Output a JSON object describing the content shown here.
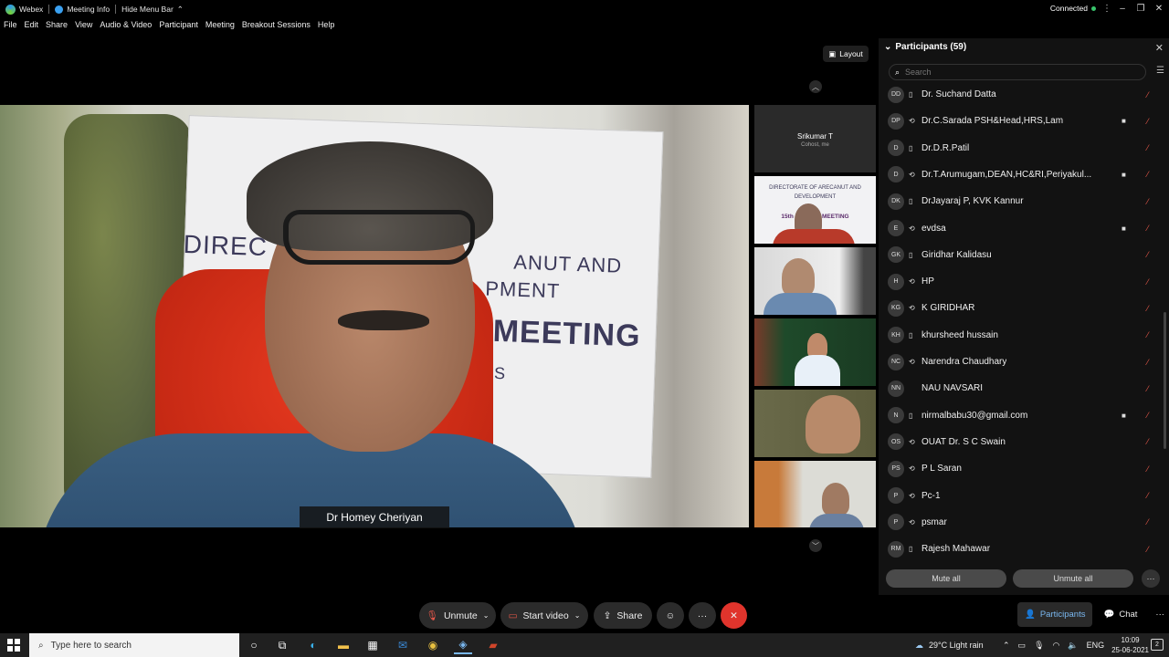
{
  "titlebar": {
    "app_name": "Webex",
    "meeting_info": "Meeting Info",
    "hide_menu_bar": "Hide Menu Bar",
    "status": "Connected"
  },
  "menu": [
    "File",
    "Edit",
    "Share",
    "View",
    "Audio & Video",
    "Participant",
    "Meeting",
    "Breakout Sessions",
    "Help"
  ],
  "layout_button": "Layout",
  "main_video": {
    "speaker_name": "Dr Homey Cheriyan",
    "banner_line1": "DIREC",
    "banner_line2": "ANUT AND",
    "banner_line3": "PMENT",
    "banner_line4": "MEETING",
    "banner_line5": "ES"
  },
  "thumbnails": {
    "first": {
      "name": "Srikumar T",
      "role": "Cohost, me"
    },
    "banner_line1": "DIRECTORATE OF ARECANUT AND",
    "banner_line2": "DEVELOPMENT",
    "banner_line3": "15th AN    VIEW MEETING"
  },
  "participants_panel": {
    "title": "Participants (59)",
    "search_placeholder": "Search",
    "mute_all": "Mute all",
    "unmute_all": "Unmute all",
    "participants": [
      {
        "initials": "DD",
        "name": "Dr. Suchand Datta",
        "device": "phone",
        "video": false
      },
      {
        "initials": "DP",
        "name": "Dr.C.Sarada PSH&Head,HRS,Lam",
        "device": "audio",
        "video": true
      },
      {
        "initials": "D",
        "name": "Dr.D.R.Patil",
        "device": "phone",
        "video": false
      },
      {
        "initials": "D",
        "name": "Dr.T.Arumugam,DEAN,HC&RI,Periyakul...",
        "device": "audio",
        "video": true
      },
      {
        "initials": "DK",
        "name": "DrJayaraj P, KVK Kannur",
        "device": "phone",
        "video": false
      },
      {
        "initials": "E",
        "name": "evdsa",
        "device": "audio",
        "video": true
      },
      {
        "initials": "GK",
        "name": "Giridhar Kalidasu",
        "device": "phone",
        "video": false
      },
      {
        "initials": "H",
        "name": "HP",
        "device": "audio",
        "video": false
      },
      {
        "initials": "KG",
        "name": "K GIRIDHAR",
        "device": "audio",
        "video": false
      },
      {
        "initials": "KH",
        "name": "khursheed hussain",
        "device": "phone",
        "video": false
      },
      {
        "initials": "NC",
        "name": "Narendra Chaudhary",
        "device": "audio",
        "video": false
      },
      {
        "initials": "NN",
        "name": "NAU NAVSARI",
        "device": "none",
        "video": false
      },
      {
        "initials": "N",
        "name": "nirmalbabu30@gmail.com",
        "device": "phone",
        "video": true
      },
      {
        "initials": "OS",
        "name": "OUAT Dr. S C Swain",
        "device": "audio",
        "video": false
      },
      {
        "initials": "PS",
        "name": "P L Saran",
        "device": "audio",
        "video": false
      },
      {
        "initials": "P",
        "name": "Pc-1",
        "device": "audio",
        "video": false
      },
      {
        "initials": "P",
        "name": "psmar",
        "device": "audio",
        "video": false
      },
      {
        "initials": "RM",
        "name": "Rajesh Mahawar",
        "device": "phone",
        "video": false
      }
    ]
  },
  "controls": {
    "unmute": "Unmute",
    "start_video": "Start video",
    "share": "Share",
    "participants_tab": "Participants",
    "chat_tab": "Chat"
  },
  "taskbar": {
    "search_placeholder": "Type here to search",
    "weather": "29°C  Light rain",
    "language": "ENG",
    "time": "10:09",
    "date": "25-06-2021",
    "notification_count": "2"
  },
  "colors": {
    "accent_blue": "#7ab8f0",
    "end_red": "#e0342c",
    "muted_red": "#e8584a",
    "connected_green": "#39c46c"
  }
}
